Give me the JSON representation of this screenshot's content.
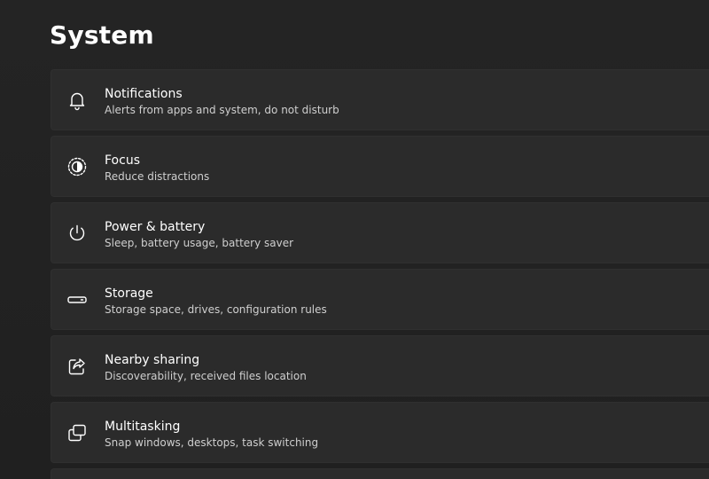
{
  "header": {
    "title": "System"
  },
  "items": [
    {
      "title": "Notifications",
      "subtitle": "Alerts from apps and system, do not disturb",
      "icon": "bell-icon"
    },
    {
      "title": "Focus",
      "subtitle": "Reduce distractions",
      "icon": "focus-icon"
    },
    {
      "title": "Power & battery",
      "subtitle": "Sleep, battery usage, battery saver",
      "icon": "power-icon"
    },
    {
      "title": "Storage",
      "subtitle": "Storage space, drives, configuration rules",
      "icon": "storage-icon"
    },
    {
      "title": "Nearby sharing",
      "subtitle": "Discoverability, received files location",
      "icon": "share-icon"
    },
    {
      "title": "Multitasking",
      "subtitle": "Snap windows, desktops, task switching",
      "icon": "multitasking-icon"
    }
  ],
  "colors": {
    "background": "#202020",
    "card": "#2b2b2b",
    "text": "#ffffff",
    "subtext": "#cfcfcf"
  }
}
